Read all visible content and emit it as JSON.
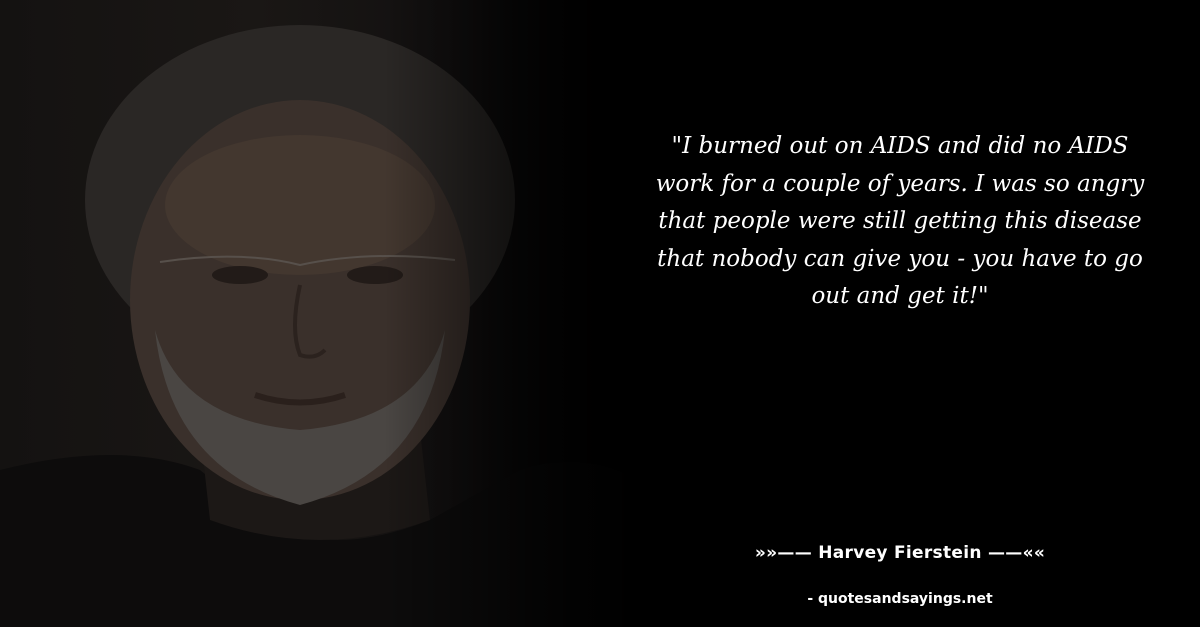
{
  "quote": {
    "text": "\"I burned out on AIDS and did no AIDS work for a couple of years. I was so angry that people were still getting this disease that nobody can give you - you have to go out and get it!\""
  },
  "author": {
    "line": "»»—— Harvey Fierstein ——««"
  },
  "source": {
    "line": "- quotesandsayings.net"
  },
  "colors": {
    "background": "#000000",
    "text": "#ffffff"
  }
}
